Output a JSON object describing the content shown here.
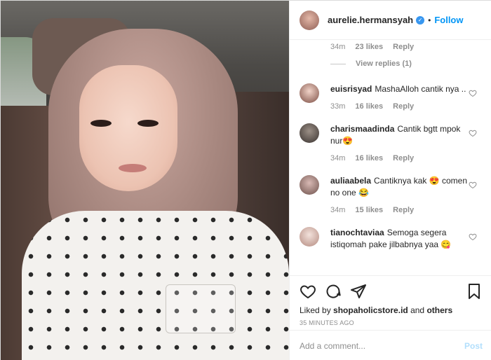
{
  "post": {
    "username": "aurelie.hermansyah",
    "follow_label": "Follow",
    "separator": "•",
    "verified_icon": "verified-badge-icon"
  },
  "first_comment_meta": {
    "time": "34m",
    "likes": "23 likes",
    "reply": "Reply",
    "view_replies": "View replies (1)"
  },
  "comments": [
    {
      "username": "euisrisyad",
      "text": "MashaAlloh cantik nya ..",
      "time": "33m",
      "likes": "16 likes",
      "reply": "Reply"
    },
    {
      "username": "charismaadinda",
      "text": "Cantik bgtt mpok nur😍",
      "time": "34m",
      "likes": "16 likes",
      "reply": "Reply"
    },
    {
      "username": "auliaabela",
      "text": "Cantiknya kak 😍 comen no one 😂",
      "time": "34m",
      "likes": "15 likes",
      "reply": "Reply"
    },
    {
      "username": "tianochtaviaa",
      "text": "Semoga segera istiqomah pake jilbabnya yaa 😋",
      "time": "",
      "likes": "",
      "reply": ""
    }
  ],
  "actions": {
    "icons": [
      "heart-icon",
      "comment-icon",
      "share-icon",
      "bookmark-icon"
    ],
    "liked_by_prefix": "Liked by",
    "liked_by_user": "shopaholicstore.id",
    "liked_by_and": "and",
    "liked_by_others": "others",
    "timestamp": "35 MINUTES AGO"
  },
  "add_comment": {
    "placeholder": "Add a comment...",
    "post_label": "Post"
  },
  "colors": {
    "accent": "#0095f6",
    "muted": "#8e8e8e",
    "text": "#262626",
    "post_disabled": "#b2dffc"
  }
}
